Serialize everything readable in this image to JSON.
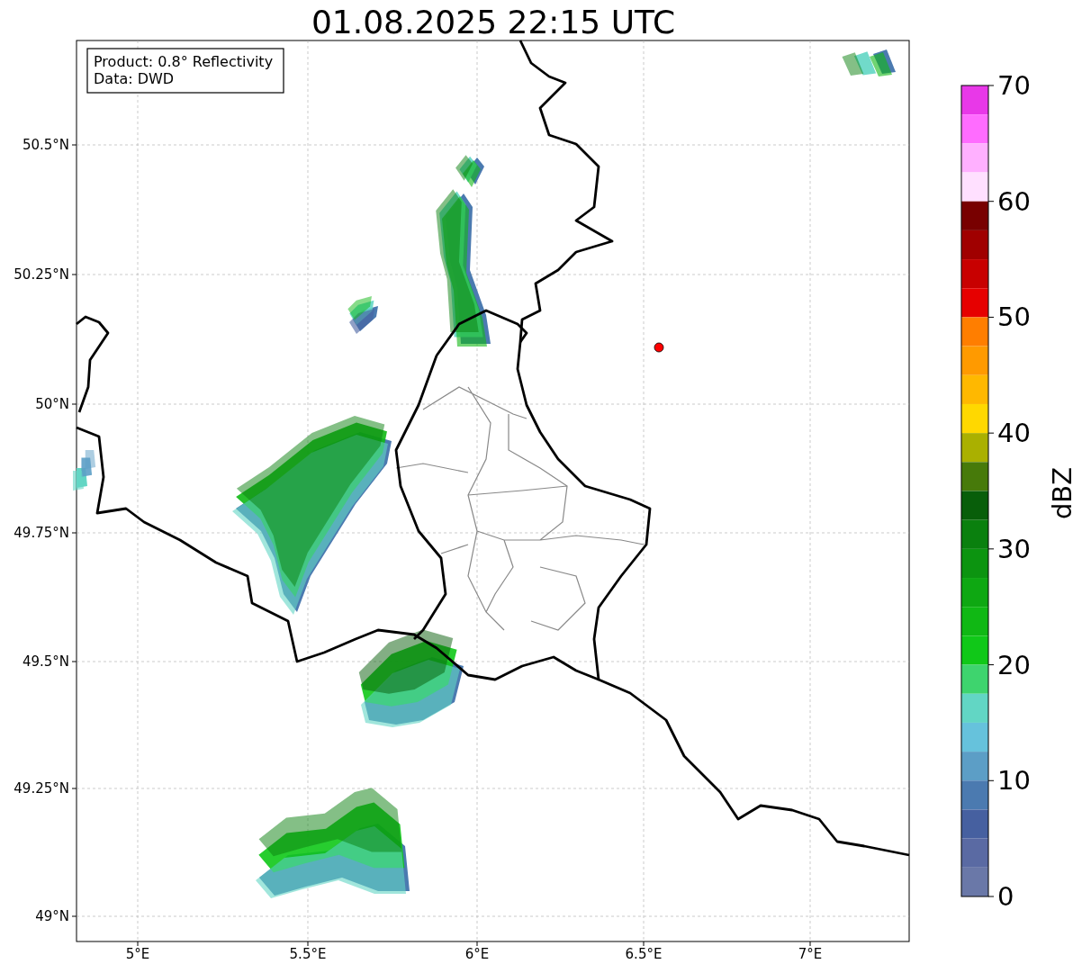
{
  "title": "01.08.2025 22:15 UTC",
  "info_box": [
    "Product: 0.8° Reflectivity",
    "Data: DWD"
  ],
  "x_ticks": [
    "5°E",
    "5.5°E",
    "6°E",
    "6.5°E",
    "7°E"
  ],
  "y_ticks": [
    "50.5°N",
    "50.25°N",
    "50°N",
    "49.75°N",
    "49.5°N",
    "49.25°N",
    "49°N"
  ],
  "colorbar": {
    "label": "dBZ",
    "ticks": [
      "70",
      "60",
      "50",
      "40",
      "30",
      "20",
      "10",
      "0"
    ],
    "bands": [
      {
        "color": "#e838e8"
      },
      {
        "color": "#ff6cff"
      },
      {
        "color": "#ffb0ff"
      },
      {
        "color": "#ffe0ff"
      },
      {
        "color": "#780000"
      },
      {
        "color": "#a00000"
      },
      {
        "color": "#c80000"
      },
      {
        "color": "#e60000"
      },
      {
        "color": "#ff7e00"
      },
      {
        "color": "#ff9a00"
      },
      {
        "color": "#ffb800"
      },
      {
        "color": "#ffd800"
      },
      {
        "color": "#aab000"
      },
      {
        "color": "#477a0a"
      },
      {
        "color": "#085e0a"
      },
      {
        "color": "#0a800e"
      },
      {
        "color": "#0c9410"
      },
      {
        "color": "#0ea812"
      },
      {
        "color": "#10b814"
      },
      {
        "color": "#10c818"
      },
      {
        "color": "#3ed46e"
      },
      {
        "color": "#62d6c4"
      },
      {
        "color": "#66c2dc"
      },
      {
        "color": "#5c9ec6"
      },
      {
        "color": "#4b7ab0"
      },
      {
        "color": "#4660a0"
      },
      {
        "color": "#5a6aa3"
      },
      {
        "color": "#6a78a8"
      }
    ]
  }
}
